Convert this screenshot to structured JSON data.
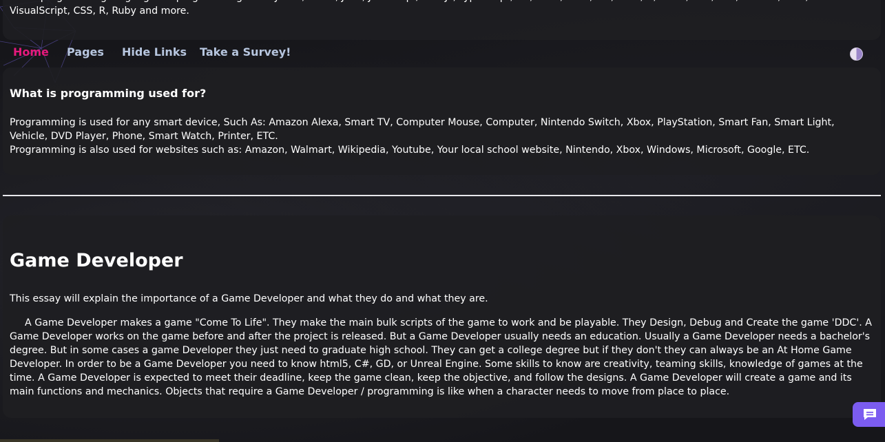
{
  "top_section": {
    "text": "Some programming languages of programming are: Python, Kotlin, Java, Javascript/NodeJs, TypeScript, Go, Swift, Html, C#, C++, C, Scala, PHP, Perl, MatLab, Rust, VisualScript, CSS, R, Ruby and more."
  },
  "nav": {
    "home": "Home",
    "pages": "Pages",
    "hide_links": "Hide Links",
    "survey": "Take a Survey!",
    "active_color": "#e6197d",
    "link_color": "#b7c6df",
    "toggle_icon": "theme-toggle-icon"
  },
  "programming_section": {
    "heading": "What is programming used for?",
    "line1": "Programming is used for any smart device, Such As: Amazon Alexa, Smart TV, Computer Mouse, Computer, Nintendo Switch, Xbox, PlayStation, Smart Fan, Smart Light, Vehicle, DVD Player, Phone, Smart Watch, Printer, ETC.",
    "line2": "Programming is also used for websites such as: Amazon, Walmart, Wikipedia, Youtube, Your local school website, Nintendo, Xbox, Windows, Microsoft, Google, ETC."
  },
  "game_section": {
    "title": "Game Developer",
    "intro": "This essay will explain the importance of a Game Developer and what they do and what they are.",
    "essay": "A Game Developer makes a game \"Come To Life\". They make the main bulk scripts of the game to work and be playable. They Design, Debug and Create the game 'DDC'. A Game Developer works on the game before and after the project is released. But a Game Developer usually needs an education. Usually a Game Developer needs a bachelor's degree. But in some cases a game Developer they just need to graduate high school. They can get a college degree but if they don't they can always be an At Home Game Developer. In order to be a Game Developer you need to know html5, C#, GD, or Unreal Engine. Some skills to know are creativity, teaming skills, knowledge of games at the time. A Game Developer is expected to meet their deadline, keep the game clean, keep the objective, and follow the designs. A Game Developer will create a game and its main functions and mechanics. Objects that require a Game Developer / programming is like when a character needs to move from place to place."
  },
  "chat": {
    "icon": "chat-icon",
    "color": "#7b5cf0"
  }
}
